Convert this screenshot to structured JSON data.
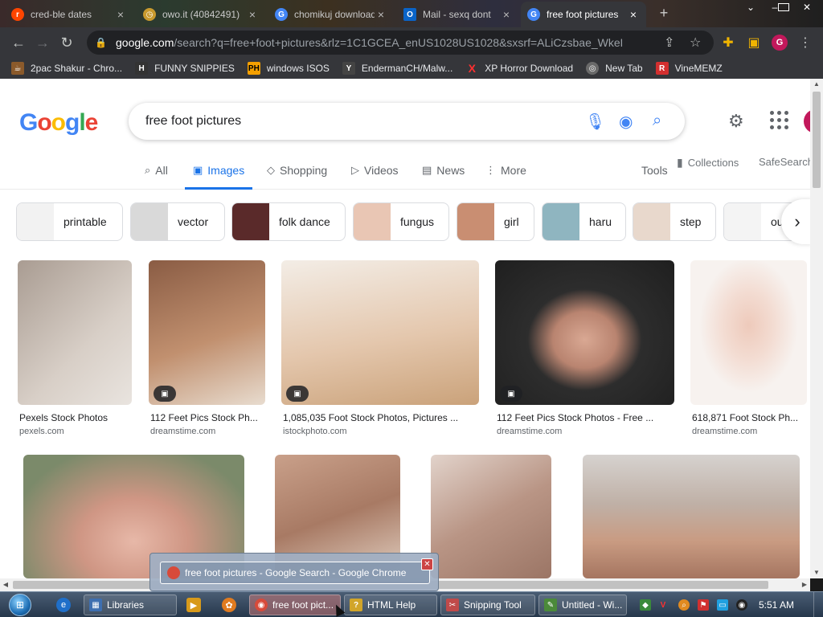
{
  "browser": {
    "tabs": [
      {
        "title": "cred-ble dates",
        "icon": "reddit-icon",
        "color": "#ff4500"
      },
      {
        "title": "owo.it (40842491)",
        "icon": "clock-icon",
        "color": "#c99a2e"
      },
      {
        "title": "chomikuj download",
        "icon": "google-icon",
        "color": "#4285f4"
      },
      {
        "title": "Mail - sexq dont",
        "icon": "outlook-icon",
        "color": "#0a64c8"
      },
      {
        "title": "free foot pictures",
        "icon": "google-icon",
        "color": "#4285f4",
        "active": true
      }
    ],
    "url_host": "google.com",
    "url_path": "/search?q=free+foot+pictures&rlz=1C1GCEA_enUS1028US1028&sxsrf=ALiCzsbae_WkeDhnEE...",
    "profile_letter": "G",
    "bookmarks": [
      {
        "label": "2pac Shakur - Chro...",
        "icon": "coffee-cup-icon",
        "color": "#8b5a2b",
        "glyph": "☕"
      },
      {
        "label": "FUNNY SNIPPIES",
        "icon": "h-letter-icon",
        "color": "#333333",
        "glyph": "H"
      },
      {
        "label": "windows ISOS",
        "icon": "ph-icon",
        "color": "#f5a000",
        "glyph": "PH"
      },
      {
        "label": "EndermanCH/Malw...",
        "icon": "yp-icon",
        "color": "#444444",
        "glyph": "Y"
      },
      {
        "label": "XP Horror Download",
        "icon": "x-icon",
        "color": "#d32f2f",
        "glyph": "X"
      },
      {
        "label": "New Tab",
        "icon": "globe-icon",
        "color": "#6a6a6a",
        "glyph": "◎"
      },
      {
        "label": "VineMEMZ",
        "icon": "r-letter-icon",
        "color": "#d32f2f",
        "glyph": "R"
      }
    ]
  },
  "google": {
    "logo_letters": [
      {
        "ch": "G",
        "color": "#4285f4"
      },
      {
        "ch": "o",
        "color": "#ea4335"
      },
      {
        "ch": "o",
        "color": "#fbbc05"
      },
      {
        "ch": "g",
        "color": "#4285f4"
      },
      {
        "ch": "l",
        "color": "#34a853"
      },
      {
        "ch": "e",
        "color": "#ea4335"
      }
    ],
    "query": "free foot pictures",
    "nav_tabs": [
      {
        "label": "All",
        "icon": "search-icon",
        "glyph": "🔍"
      },
      {
        "label": "Images",
        "icon": "image-icon",
        "glyph": "▣",
        "active": true
      },
      {
        "label": "Shopping",
        "icon": "tag-icon",
        "glyph": "◇"
      },
      {
        "label": "Videos",
        "icon": "play-icon",
        "glyph": "▷"
      },
      {
        "label": "News",
        "icon": "newspaper-icon",
        "glyph": "▤"
      },
      {
        "label": "More",
        "icon": "more-vertical-icon",
        "glyph": "⋮"
      }
    ],
    "tools_label": "Tools",
    "collections_label": "Collections",
    "safesearch_label": "SafeSearch",
    "chips": [
      {
        "label": "printable",
        "color": "#f2f2f2"
      },
      {
        "label": "vector",
        "color": "#d9d9d9"
      },
      {
        "label": "folk dance",
        "color": "#5a2a2a"
      },
      {
        "label": "fungus",
        "color": "#e9c6b4"
      },
      {
        "label": "girl",
        "color": "#c98e72"
      },
      {
        "label": "haru",
        "color": "#8fb5c0"
      },
      {
        "label": "step",
        "color": "#e8d8cc"
      },
      {
        "label": "outline",
        "color": "#f4f4f4"
      }
    ],
    "results_row1": [
      {
        "title": "Pexels Stock Photos",
        "source": "pexels.com",
        "color": "#b8aca3",
        "badge": false
      },
      {
        "title": "112 Feet Pics Stock Ph...",
        "source": "dreamstime.com",
        "color": "#a8765c",
        "badge": true
      },
      {
        "title": "1,085,035 Foot Stock Photos, Pictures ...",
        "source": "istockphoto.com",
        "color": "#e3cdb7",
        "badge": true
      },
      {
        "title": "112 Feet Pics Stock Photos - Free ...",
        "source": "dreamstime.com",
        "color": "#3a3a3a",
        "badge": true
      },
      {
        "title": "618,871 Foot Stock Ph...",
        "source": "dreamstime.com",
        "color": "#f1ddd4",
        "badge": false
      }
    ],
    "results_row2": [
      {
        "color": "#d9a79a"
      },
      {
        "color": "#b48974"
      },
      {
        "color": "#c3a394"
      },
      {
        "color": "#b7a69a"
      }
    ]
  },
  "taskbar": {
    "items": [
      {
        "label": "Libraries",
        "icon": "folder-icon",
        "color": "#3e6fb0",
        "glyph": "▦"
      },
      {
        "label": "free foot pict...",
        "icon": "chrome-icon",
        "color": "#d84a3a",
        "glyph": "◉",
        "active": true
      },
      {
        "label": "HTML Help",
        "icon": "help-icon",
        "color": "#d1a52a",
        "glyph": "?"
      },
      {
        "label": "Snipping Tool",
        "icon": "scissors-icon",
        "color": "#c04a4a",
        "glyph": "✂"
      },
      {
        "label": "Untitled - Wi...",
        "icon": "notepad-icon",
        "color": "#4b8a3a",
        "glyph": "✎"
      }
    ],
    "preview_title": "free foot pictures - Google Search - Google Chrome",
    "clock": "5:51 AM"
  }
}
